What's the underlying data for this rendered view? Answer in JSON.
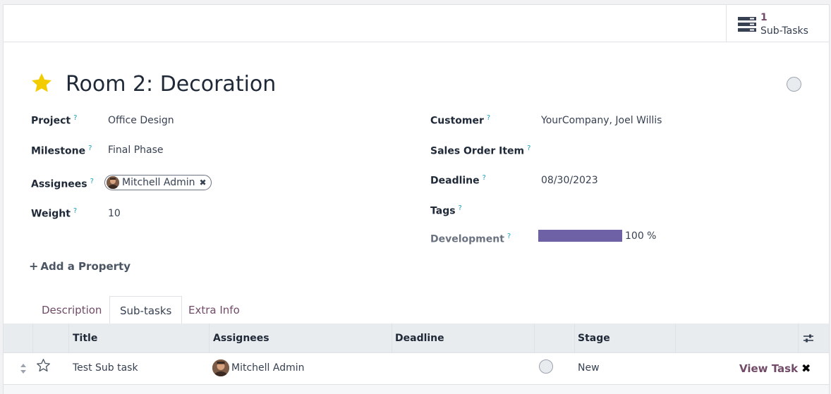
{
  "stat_button": {
    "count": "1",
    "label": "Sub-Tasks"
  },
  "task": {
    "title": "Room 2: Decoration"
  },
  "fields_left": {
    "project": {
      "label": "Project",
      "help": "?",
      "value": "Office Design"
    },
    "milestone": {
      "label": "Milestone",
      "help": "?",
      "value": "Final Phase"
    },
    "assignees": {
      "label": "Assignees",
      "help": "?",
      "tag": "Mitchell Admin"
    },
    "weight": {
      "label": "Weight",
      "help": "?",
      "value": "10"
    }
  },
  "fields_right": {
    "customer": {
      "label": "Customer",
      "help": "?",
      "value": "YourCompany, Joel Willis"
    },
    "sales_order_item": {
      "label": "Sales Order Item",
      "help": "?",
      "value": ""
    },
    "deadline": {
      "label": "Deadline",
      "help": "?",
      "value": "08/30/2023"
    },
    "tags": {
      "label": "Tags",
      "help": "?",
      "value": ""
    },
    "development": {
      "label": "Development",
      "help": "?",
      "progress_text": "100 %",
      "progress_fraction": 1.0
    }
  },
  "add_property": "Add a Property",
  "tabs": [
    {
      "label": "Description",
      "active": false
    },
    {
      "label": "Sub-tasks",
      "active": true
    },
    {
      "label": "Extra Info",
      "active": false
    }
  ],
  "table": {
    "columns": [
      "Title",
      "Assignees",
      "Deadline",
      "Stage"
    ],
    "rows": [
      {
        "title": "Test Sub task",
        "assignee": "Mitchell Admin",
        "deadline": "",
        "stage": "New",
        "action": "View Task"
      }
    ]
  },
  "colors": {
    "accent": "#714b67",
    "progress": "#6f61a6",
    "star": "#f3cc00",
    "help": "#17a2b8"
  },
  "icons": [
    "subtasks-icon",
    "star-icon",
    "status-circle-icon",
    "plus-icon",
    "remove-icon",
    "drag-handle-icon",
    "optional-columns-icon",
    "delete-icon"
  ]
}
